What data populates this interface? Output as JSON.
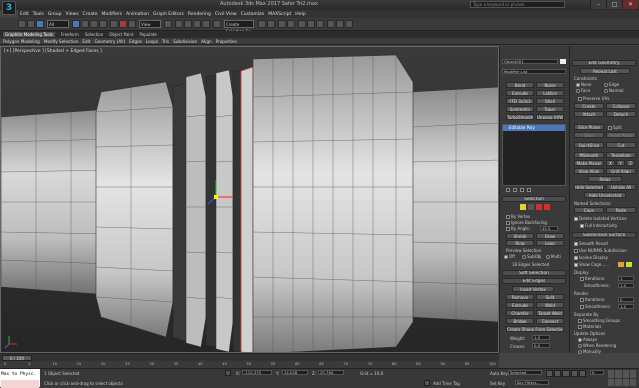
{
  "window": {
    "title": "Autodesk 3ds Max 2017   Safer Tri2.max",
    "search_placeholder": "Type a keyword or phrase",
    "minimize": "–",
    "maximize": "□",
    "close": "✕"
  },
  "menus": [
    "Edit",
    "Tools",
    "Group",
    "Views",
    "Create",
    "Modifiers",
    "Animation",
    "Graph Editors",
    "Rendering",
    "Civil View",
    "Customize",
    "MAXScript",
    "Help"
  ],
  "toolbar": {
    "filter_select": "All",
    "view_select": "View",
    "selection_set": "Create Selection Se"
  },
  "ribbon": {
    "tabs": [
      "Graphite Modeling Tools",
      "Freeform",
      "Selection",
      "Object Paint",
      "Populate"
    ],
    "active_tab": "Graphite Modeling Tools",
    "subtabs": [
      "Polygon Modeling",
      "Modify Selection",
      "Edit",
      "Geometry (All)",
      "Edges",
      "Loops",
      "Tris",
      "Subdivision",
      "Align",
      "Properties"
    ]
  },
  "viewport": {
    "label": "[+] [Perspective ] [Shaded + Edged Faces ]"
  },
  "modifier_panel": {
    "object_name": "Object001",
    "modifier_list": "Modifier List",
    "buttons": [
      "Bend",
      "Noise",
      "Extrude",
      "Lattice",
      "FFD 3x3x3",
      "Shell",
      "Symmetry",
      "Taper",
      "TurboSmooth",
      "Unwrap UVW"
    ],
    "stack_item": "Editable Poly"
  },
  "selection_rollout": {
    "title": "Selection",
    "by_vertex": "By Vertex",
    "ignore_backfacing": "Ignore Backfacing",
    "by_angle": "By Angle:",
    "angle_value": "45.0",
    "shrink": "Shrink",
    "grow": "Grow",
    "ring": "Ring",
    "loop": "Loop",
    "preview_selection": "Preview Selection",
    "off": "Off",
    "subobj": "SubObj",
    "multi": "Multi",
    "status": "18 Edges Selected"
  },
  "soft_selection": {
    "title": "Soft Selection"
  },
  "edit_edges": {
    "title": "Edit Edges",
    "insert_vertex": "Insert Vertex",
    "remove": "Remove",
    "split": "Split",
    "extrude": "Extrude",
    "weld": "Weld",
    "chamfer": "Chamfer",
    "target_weld": "Target Weld",
    "bridge": "Bridge",
    "connect": "Connect",
    "create_shape": "Create Shape From Selection",
    "weight_label": "Weight:",
    "weight_value": "1.0",
    "crease_label": "Crease:",
    "crease_value": "0.0"
  },
  "edit_geometry": {
    "title": "Edit Geometry",
    "repeat_last": "Repeat Last",
    "constraints": "Constraints",
    "none": "None",
    "edge": "Edge",
    "face": "Face",
    "normal": "Normal",
    "preserve_uvs": "Preserve UVs",
    "create": "Create",
    "collapse": "Collapse",
    "attach": "Attach",
    "detach": "Detach",
    "slice_plane": "Slice Plane",
    "split": "Split",
    "slice": "Slice",
    "reset_plane": "Reset Plane",
    "quickslice": "QuickSlice",
    "cut": "Cut",
    "msmooth": "MSmooth",
    "tessellate": "Tessellate",
    "make_planar": "Make Planar",
    "x": "X",
    "y": "Y",
    "z": "Z",
    "view_align": "View Align",
    "grid_align": "Grid Align",
    "relax": "Relax",
    "hide_selected": "Hide Selected",
    "unhide_all": "Unhide All",
    "hide_unselected": "Hide Unselected",
    "named_selections": "Named Selections:",
    "copy": "Copy",
    "paste": "Paste",
    "delete_isolated": "Delete Isolated Vertices",
    "full_interactivity": "Full Interactivity"
  },
  "subdivision_surface": {
    "title": "Subdivision Surface",
    "smooth_result": "Smooth Result",
    "use_nurms": "Use NURMS Subdivision",
    "isoline_display": "Isoline Display",
    "show_cage": "Show Cage......",
    "display": "Display",
    "iterations_label": "Iterations:",
    "iterations_value": "1",
    "smoothness_label": "Smoothness:",
    "smoothness_value": "1.0",
    "render": "Render",
    "render_iterations": "0",
    "render_smoothness": "1.0",
    "separate_by": "Separate By",
    "smoothing_groups": "Smoothing Groups",
    "materials": "Materials",
    "update_options": "Update Options",
    "always": "Always",
    "when_rendering": "When Rendering",
    "manually": "Manually"
  },
  "timeline": {
    "frame": "0 / 100",
    "ticks": [
      "0",
      "5",
      "10",
      "15",
      "20",
      "25",
      "30",
      "35",
      "40",
      "45",
      "50",
      "55",
      "60",
      "65",
      "70",
      "75",
      "80",
      "85",
      "90",
      "95",
      "100"
    ]
  },
  "status": {
    "maxscript_text": "Max to Physc.",
    "objects_selected": "1 Object Selected",
    "prompt": "Click or click-and-drag to select objects",
    "x_label": "X:",
    "x_value": "-115.375",
    "y_label": "Y:",
    "y_value": "14.028",
    "z_label": "Z:",
    "z_value": "25.784",
    "grid": "Grid = 10.0",
    "add_time_tag": "Add Time Tag",
    "auto_key": "Auto Key",
    "selected": "Selected",
    "set_key": "Set Key",
    "key_filters": "Key Filters...",
    "frame_field": "0"
  },
  "colors": {
    "accent_blue": "#4a78b8",
    "selection_red": "#d03030",
    "selected_edge": "#c84040"
  }
}
